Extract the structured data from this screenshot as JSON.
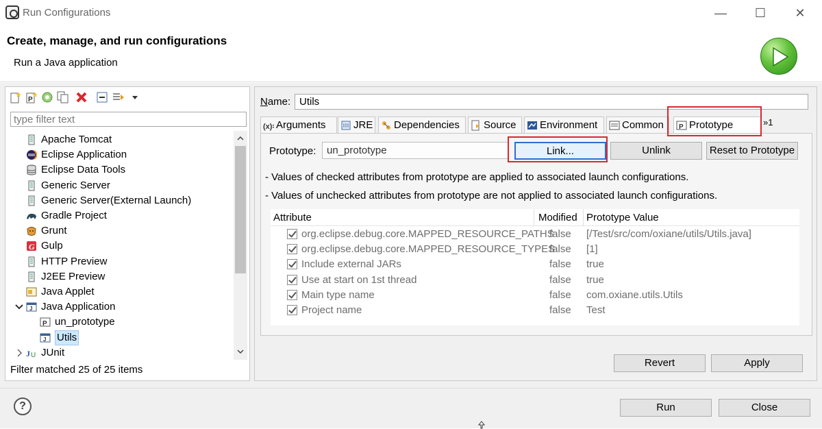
{
  "window": {
    "title": "Run Configurations",
    "minimize": "—",
    "maximize": "☐",
    "close": "✕"
  },
  "header": {
    "title": "Create, manage, and run configurations",
    "subtitle": "Run a Java application"
  },
  "left": {
    "filter_placeholder": "type filter text",
    "tree": [
      {
        "label": "Apache Tomcat",
        "icon": "server-icon",
        "indent": 0
      },
      {
        "label": "Eclipse Application",
        "icon": "eclipse-icon",
        "indent": 0
      },
      {
        "label": "Eclipse Data Tools",
        "icon": "database-icon",
        "indent": 0
      },
      {
        "label": "Generic Server",
        "icon": "server-icon",
        "indent": 0
      },
      {
        "label": "Generic Server(External Launch)",
        "icon": "server-icon",
        "indent": 0
      },
      {
        "label": "Gradle Project",
        "icon": "gradle-icon",
        "indent": 0
      },
      {
        "label": "Grunt",
        "icon": "grunt-icon",
        "indent": 0
      },
      {
        "label": "Gulp",
        "icon": "gulp-icon",
        "indent": 0
      },
      {
        "label": "HTTP Preview",
        "icon": "server-icon",
        "indent": 0
      },
      {
        "label": "J2EE Preview",
        "icon": "server-icon",
        "indent": 0
      },
      {
        "label": "Java Applet",
        "icon": "applet-icon",
        "indent": 0
      },
      {
        "label": "Java Application",
        "icon": "java-app-icon",
        "indent": 0,
        "expanded": true
      },
      {
        "label": "un_prototype",
        "icon": "prototype-icon",
        "indent": 1
      },
      {
        "label": "Utils",
        "icon": "java-app-icon",
        "indent": 1,
        "selected": true
      },
      {
        "label": "JUnit",
        "icon": "junit-icon",
        "indent": 0,
        "collapsed": true
      }
    ],
    "status": "Filter matched 25 of 25 items"
  },
  "right": {
    "name_label": "Name:",
    "name_value": "Utils",
    "tabs": [
      {
        "label": "Arguments",
        "icon": "arguments-icon"
      },
      {
        "label": "JRE",
        "icon": "jre-icon"
      },
      {
        "label": "Dependencies",
        "icon": "dependencies-icon"
      },
      {
        "label": "Source",
        "icon": "source-icon"
      },
      {
        "label": "Environment",
        "icon": "environment-icon"
      },
      {
        "label": "Common",
        "icon": "common-icon"
      },
      {
        "label": "Prototype",
        "icon": "prototype-icon",
        "active": true
      }
    ],
    "tab_overflow": "»1",
    "prototype_label": "Prototype:",
    "prototype_value": "un_prototype",
    "link_label": "Link...",
    "unlink_label": "Unlink",
    "reset_label": "Reset to Prototype",
    "hint_checked": "- Values of checked attributes from prototype are applied to associated launch configurations.",
    "hint_unchecked": "- Values of unchecked attributes from prototype are not applied to associated launch configurations.",
    "table": {
      "headers": [
        "Attribute",
        "Modified",
        "Prototype Value"
      ],
      "rows": [
        {
          "name": "org.eclipse.debug.core.MAPPED_RESOURCE_PATHS",
          "modified": "false",
          "value": "[/Test/src/com/oxiane/utils/Utils.java]"
        },
        {
          "name": "org.eclipse.debug.core.MAPPED_RESOURCE_TYPES",
          "modified": "false",
          "value": "[1]"
        },
        {
          "name": "Include external JARs",
          "modified": "false",
          "value": "true"
        },
        {
          "name": "Use at start on 1st thread",
          "modified": "false",
          "value": "true"
        },
        {
          "name": "Main type name",
          "modified": "false",
          "value": "com.oxiane.utils.Utils"
        },
        {
          "name": "Project name",
          "modified": "false",
          "value": "Test"
        }
      ]
    },
    "revert_label": "Revert",
    "apply_label": "Apply"
  },
  "footer": {
    "help": "?",
    "run_label": "Run",
    "close_label": "Close"
  },
  "colors": {
    "highlight_box": "#d9282f",
    "focus_border": "#2f6dd0",
    "selection": "#cce8ff"
  }
}
